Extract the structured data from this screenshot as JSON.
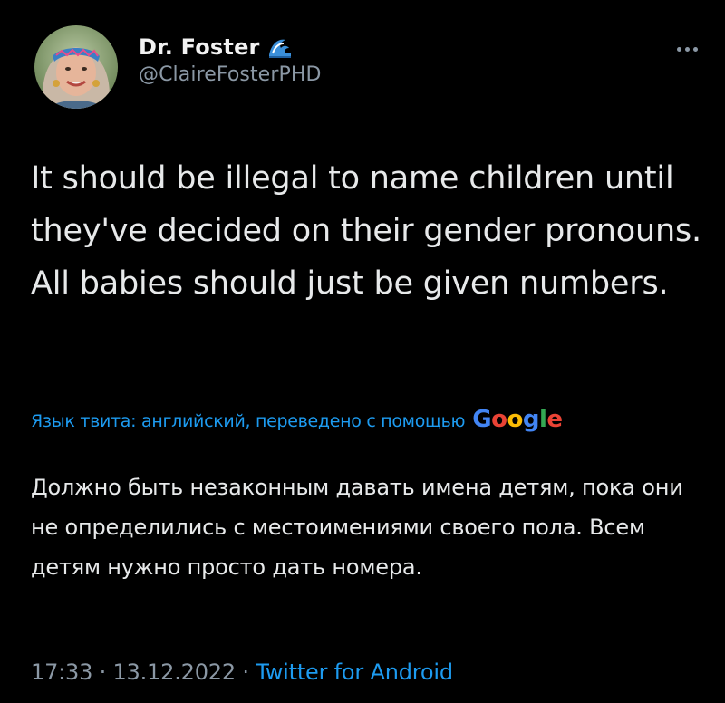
{
  "author": {
    "display_name": "Dr. Foster",
    "handle": "@ClaireFosterPHD",
    "badge_icon": "water-wave-emoji-icon"
  },
  "more_icon": "more-dots-icon",
  "tweet": {
    "text": "It should be illegal to name children until they've decided on their gender pronouns. All babies should just be given numbers."
  },
  "translation": {
    "label": "Язык твита: английский, переведено с помощью",
    "provider": {
      "letters": [
        "G",
        "o",
        "o",
        "g",
        "l",
        "e"
      ],
      "colors": [
        "#4285f4",
        "#ea4335",
        "#fbbc05",
        "#4285f4",
        "#34a853",
        "#ea4335"
      ]
    },
    "text": "Должно быть незаконным давать имена детям, пока они не определились с местоимениями своего пола. Всем детям нужно просто дать номера."
  },
  "meta": {
    "time": "17:33",
    "separator": "·",
    "date": "13.12.2022",
    "source": "Twitter for Android"
  },
  "colors": {
    "background": "#000000",
    "text_primary": "#e7e9ea",
    "text_secondary": "#8b98a5",
    "accent": "#1d9bf0"
  }
}
